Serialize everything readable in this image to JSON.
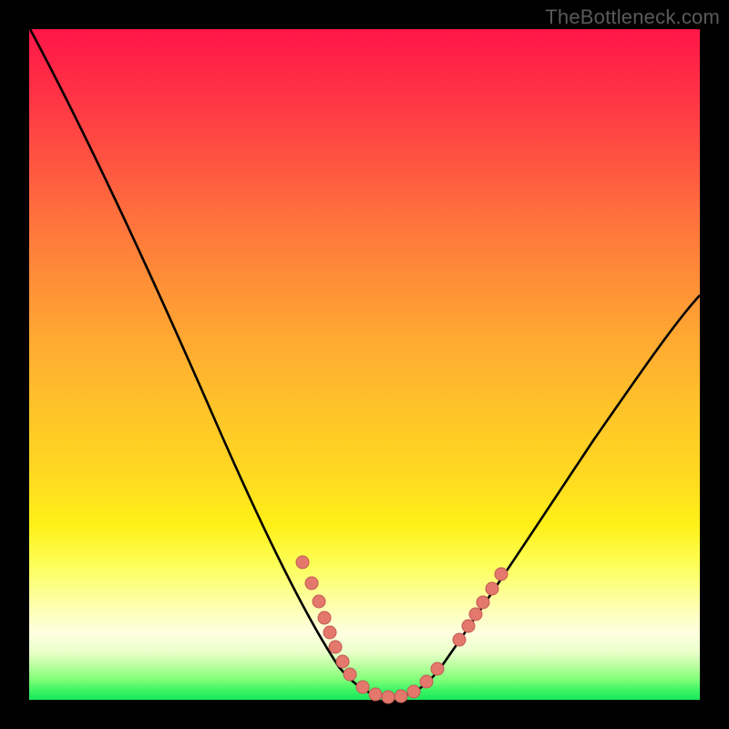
{
  "watermark": {
    "text": "TheBottleneck.com"
  },
  "colors": {
    "frame": "#000000",
    "curve_stroke": "#000000",
    "marker_fill": "#e4786d",
    "marker_stroke": "#c05a52",
    "gradient_stops": [
      "#ff1648",
      "#ff2d46",
      "#ff4743",
      "#ff6a3e",
      "#ff8a38",
      "#ffa832",
      "#ffc22a",
      "#ffd821",
      "#fff018",
      "#fdff5a",
      "#fdffae",
      "#ffffe0",
      "#e8ffc8",
      "#b8ff9e",
      "#7fff78",
      "#40f564",
      "#18e85a"
    ]
  },
  "chart_data": {
    "type": "line",
    "title": "",
    "xlabel": "",
    "ylabel": "",
    "xlim": [
      0,
      100
    ],
    "ylim": [
      0,
      100
    ],
    "grid": false,
    "legend": false,
    "series": [
      {
        "name": "curve",
        "x": [
          0,
          6,
          12,
          18,
          24,
          30,
          36,
          40,
          44,
          48,
          50,
          52,
          54,
          56,
          60,
          66,
          72,
          78,
          84,
          90,
          96,
          100
        ],
        "y": [
          100,
          90,
          79,
          67,
          55,
          43,
          31,
          23,
          15,
          7,
          3,
          1,
          0.5,
          1,
          4,
          11,
          20,
          29,
          38,
          46,
          53,
          58
        ]
      }
    ],
    "markers_x": [
      40,
      42,
      43.5,
      45,
      46,
      48,
      50,
      52,
      54,
      56,
      60,
      62,
      63.5,
      65,
      67
    ],
    "markers_y": [
      23,
      19,
      16.5,
      14,
      12,
      8,
      3,
      1,
      0.5,
      1,
      4,
      7,
      9.5,
      12,
      15
    ],
    "minimum": {
      "x": 54,
      "y": 0.5
    }
  }
}
